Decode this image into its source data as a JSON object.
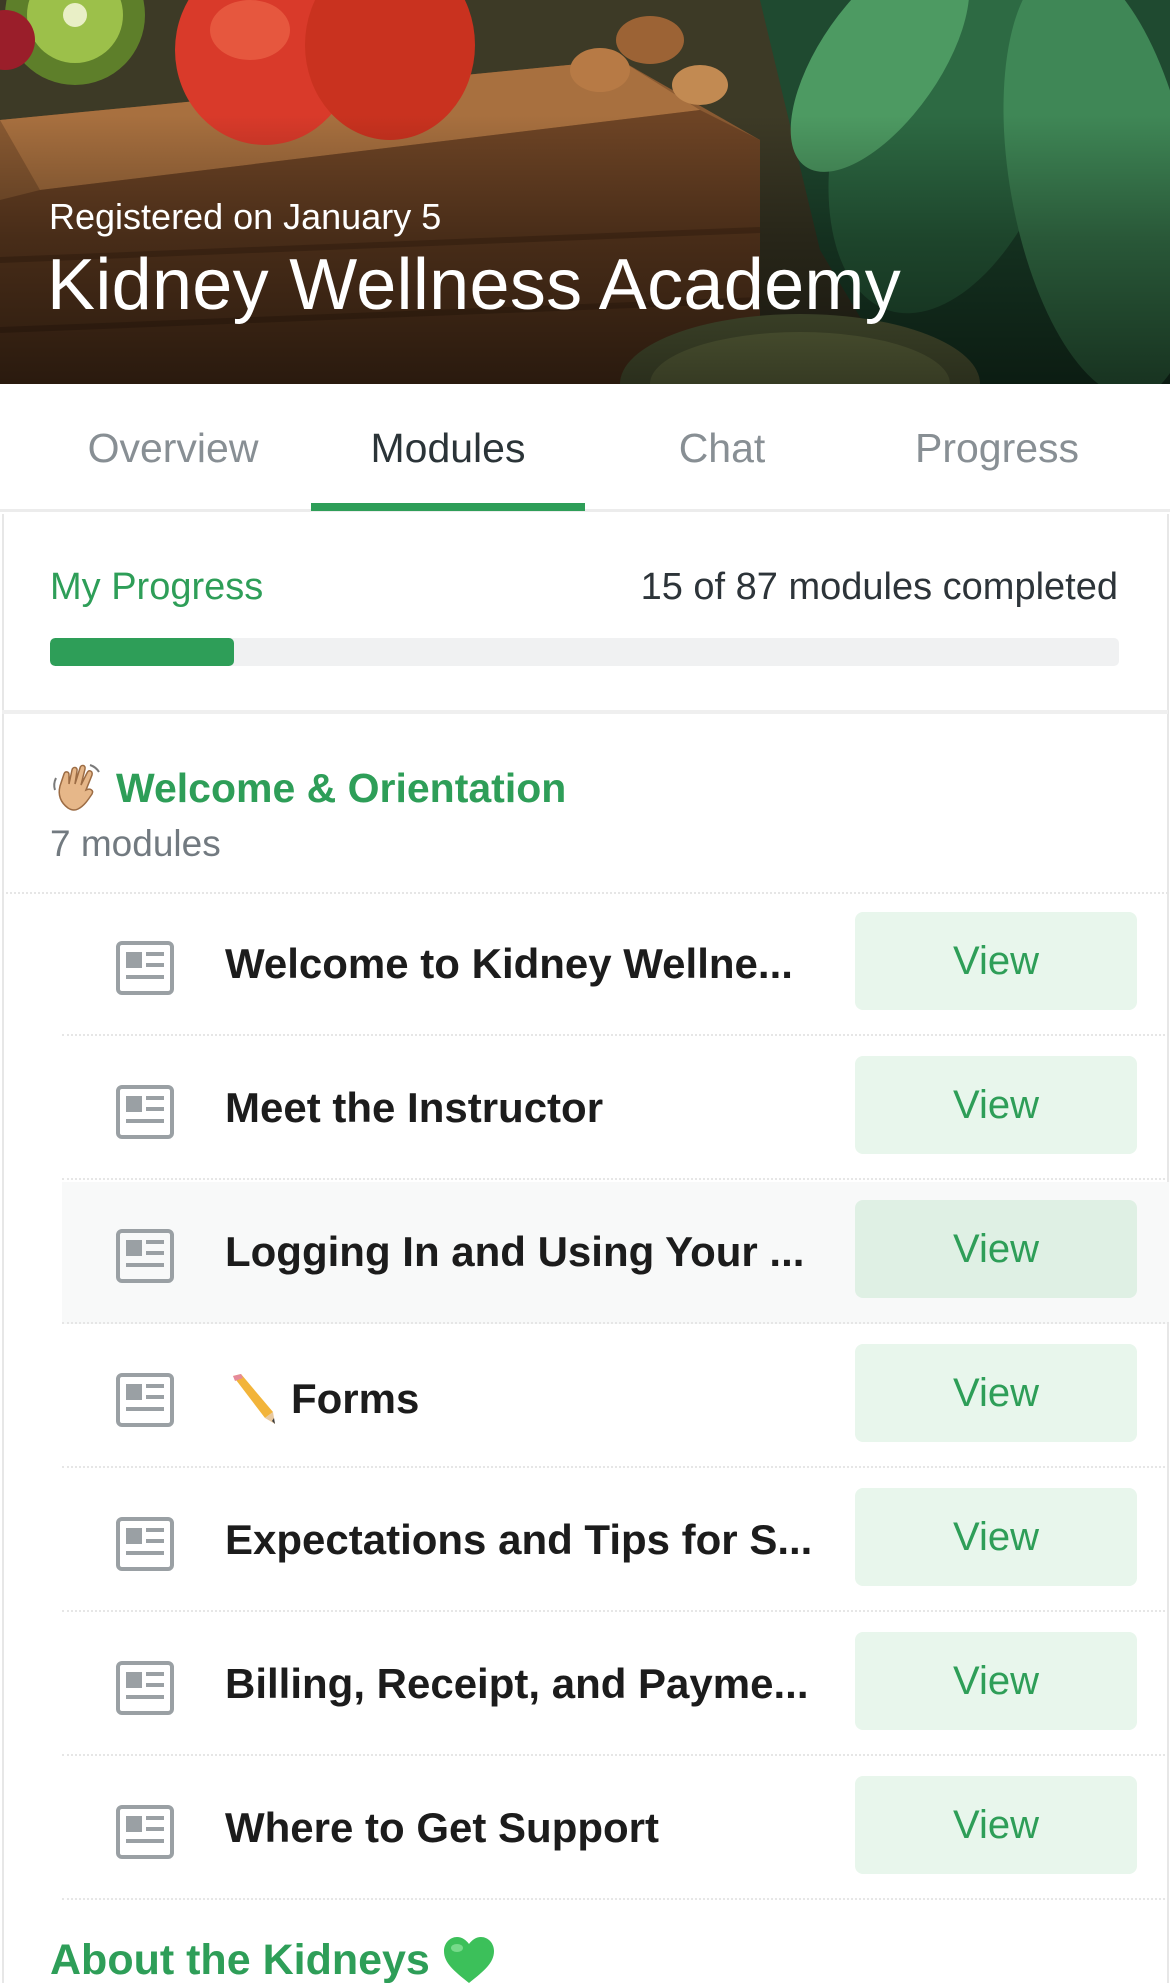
{
  "header": {
    "registered": "Registered on January 5",
    "title": "Kidney Wellness Academy"
  },
  "tabs": [
    {
      "label": "Overview",
      "active": false
    },
    {
      "label": "Modules",
      "active": true
    },
    {
      "label": "Chat",
      "active": false
    },
    {
      "label": "Progress",
      "active": false
    }
  ],
  "progress": {
    "label": "My Progress",
    "summary": "15 of 87 modules completed",
    "completed": 15,
    "total": 87
  },
  "section": {
    "icon": "waving-hand-icon",
    "title": "Welcome & Orientation",
    "count": "7 modules"
  },
  "modules": [
    {
      "title": "Welcome to Kidney Wellne...",
      "action": "View"
    },
    {
      "title": "Meet the Instructor",
      "action": "View"
    },
    {
      "title": "Logging In and Using Your ...",
      "action": "View"
    },
    {
      "title": "Forms",
      "action": "View",
      "prefix_icon": "pencil-icon"
    },
    {
      "title": "Expectations and Tips for S...",
      "action": "View"
    },
    {
      "title": "Billing, Receipt, and Payme...",
      "action": "View"
    },
    {
      "title": "Where to Get Support",
      "action": "View"
    }
  ],
  "next_section": {
    "title": "About the Kidneys",
    "icon": "green-heart-icon"
  },
  "colors": {
    "accent": "#2e9e58",
    "button_bg": "#e8f6ec",
    "muted_text": "#888f94"
  }
}
